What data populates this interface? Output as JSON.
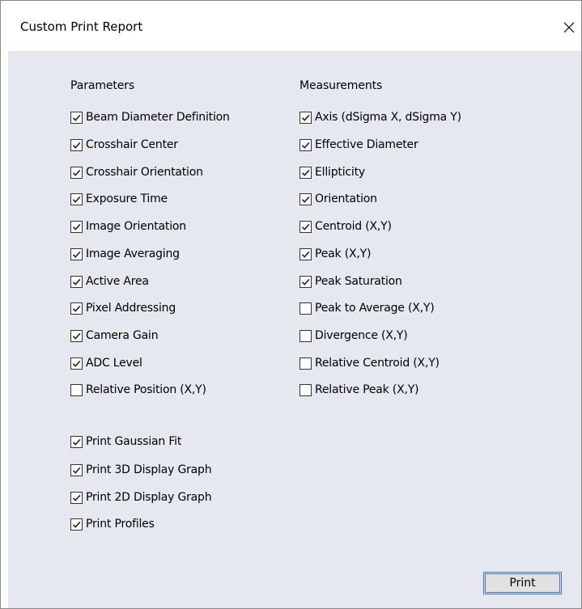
{
  "window": {
    "title": "Custom Print Report"
  },
  "parameters": {
    "heading": "Parameters",
    "items": [
      {
        "label": "Beam Diameter Definition",
        "checked": true
      },
      {
        "label": "Crosshair Center",
        "checked": true
      },
      {
        "label": "Crosshair Orientation",
        "checked": true
      },
      {
        "label": "Exposure Time",
        "checked": true
      },
      {
        "label": "Image Orientation",
        "checked": true
      },
      {
        "label": "Image Averaging",
        "checked": true
      },
      {
        "label": "Active Area",
        "checked": true
      },
      {
        "label": "Pixel Addressing",
        "checked": true
      },
      {
        "label": "Camera Gain",
        "checked": true
      },
      {
        "label": "ADC Level",
        "checked": true
      },
      {
        "label": "Relative Position (X,Y)",
        "checked": false
      }
    ]
  },
  "measurements": {
    "heading": "Measurements",
    "items": [
      {
        "label": "Axis (dSigma X, dSigma Y)",
        "checked": true
      },
      {
        "label": "Effective Diameter",
        "checked": true
      },
      {
        "label": "Ellipticity",
        "checked": true
      },
      {
        "label": "Orientation",
        "checked": true
      },
      {
        "label": "Centroid (X,Y)",
        "checked": true
      },
      {
        "label": "Peak (X,Y)",
        "checked": true
      },
      {
        "label": "Peak Saturation",
        "checked": true
      },
      {
        "label": "Peak to Average (X,Y)",
        "checked": false
      },
      {
        "label": "Divergence (X,Y)",
        "checked": false
      },
      {
        "label": "Relative Centroid (X,Y)",
        "checked": false
      },
      {
        "label": "Relative Peak (X,Y)",
        "checked": false
      }
    ]
  },
  "print_options": {
    "items": [
      {
        "label": "Print Gaussian Fit",
        "checked": true
      },
      {
        "label": "Print 3D Display Graph",
        "checked": true
      },
      {
        "label": "Print 2D Display Graph",
        "checked": true
      },
      {
        "label": "Print Profiles",
        "checked": true
      }
    ]
  },
  "buttons": {
    "print_label": "Print"
  },
  "icons": {
    "close": "close-icon",
    "check": "checkmark-icon"
  }
}
